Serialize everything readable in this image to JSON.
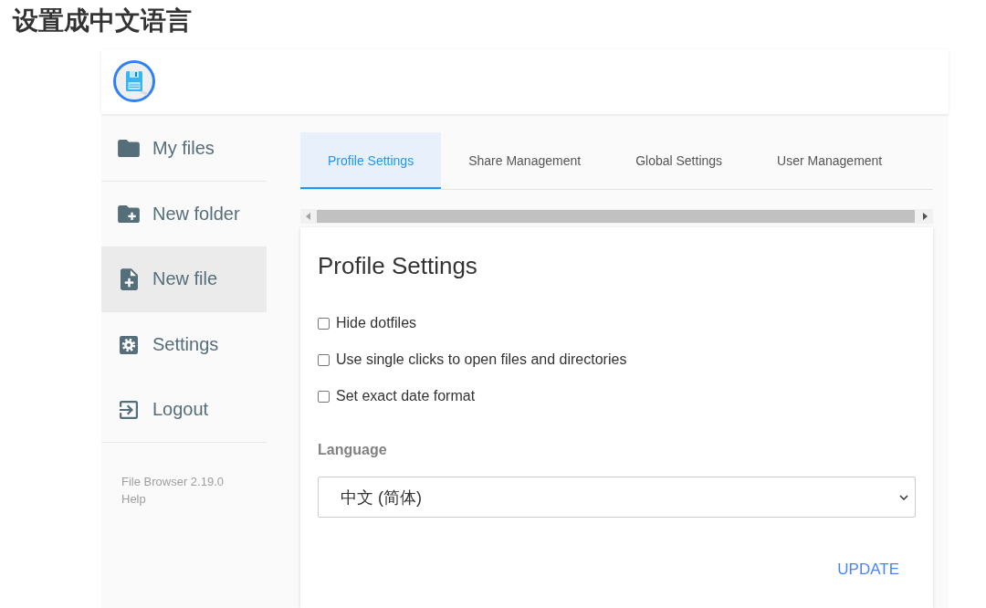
{
  "title": "设置成中文语言",
  "app": {
    "sidebar": {
      "groups": [
        {
          "items": [
            {
              "kind": "folder",
              "label": "My files",
              "highlighted": false
            }
          ]
        },
        {
          "items": [
            {
              "kind": "newfolder",
              "label": "New folder",
              "highlighted": false
            },
            {
              "kind": "newfile",
              "label": "New file",
              "highlighted": true
            }
          ]
        },
        {
          "items": [
            {
              "kind": "settings",
              "label": "Settings",
              "highlighted": false
            },
            {
              "kind": "logout",
              "label": "Logout",
              "highlighted": false
            }
          ]
        }
      ],
      "footer": {
        "version": "File Browser 2.19.0",
        "help": "Help"
      }
    },
    "tabs": [
      {
        "label": "Profile Settings",
        "selected": true
      },
      {
        "label": "Share Management",
        "selected": false
      },
      {
        "label": "Global Settings",
        "selected": false
      },
      {
        "label": "User Management",
        "selected": false
      }
    ],
    "profile_card": {
      "title": "Profile Settings",
      "options": [
        {
          "label": "Hide dotfiles",
          "checked": false
        },
        {
          "label": "Use single clicks to open files and directories",
          "checked": false
        },
        {
          "label": "Set exact date format",
          "checked": false
        }
      ],
      "language": {
        "label": "Language",
        "value": "中文 (简体)"
      },
      "button": "UPDATE"
    }
  }
}
